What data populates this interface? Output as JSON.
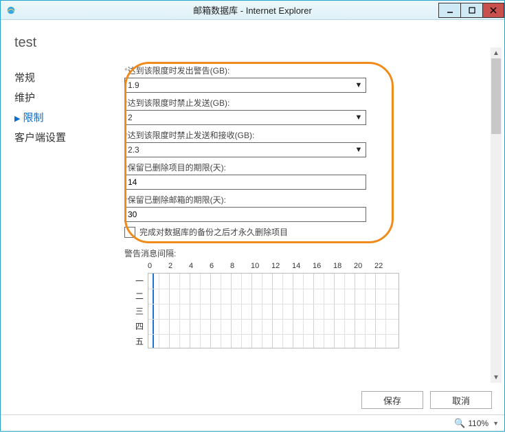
{
  "window": {
    "title": "邮箱数据库 - Internet Explorer"
  },
  "page": {
    "heading": "test"
  },
  "sidebar": {
    "items": [
      {
        "label": "常规"
      },
      {
        "label": "维护"
      },
      {
        "label": "限制"
      },
      {
        "label": "客户端设置"
      }
    ]
  },
  "form": {
    "warn_label": "达到该限度时发出警告(GB):",
    "warn_value": "1.9",
    "send_label": "达到该限度时禁止发送(GB):",
    "send_value": "2",
    "sendrecv_label": "达到该限度时禁止发送和接收(GB):",
    "sendrecv_value": "2.3",
    "keep_deleted_items_label": "保留已删除项目的期限(天):",
    "keep_deleted_items_value": "14",
    "keep_deleted_mailbox_label": "保留已删除邮箱的期限(天):",
    "keep_deleted_mailbox_value": "30",
    "backup_checkbox_label": "完成对数据库的备份之后才永久删除项目",
    "schedule_label": "警告消息间隔:"
  },
  "schedule": {
    "hours": [
      "0",
      "2",
      "4",
      "6",
      "8",
      "10",
      "12",
      "14",
      "16",
      "18",
      "20",
      "22"
    ],
    "days": [
      "一",
      "二",
      "三",
      "四",
      "五"
    ]
  },
  "buttons": {
    "save": "保存",
    "cancel": "取消"
  },
  "statusbar": {
    "zoom_text": "110%"
  },
  "icons": {
    "chevron_down": "▼",
    "scroll_up": "▲",
    "scroll_down": "▼",
    "zoom": "🔍"
  }
}
